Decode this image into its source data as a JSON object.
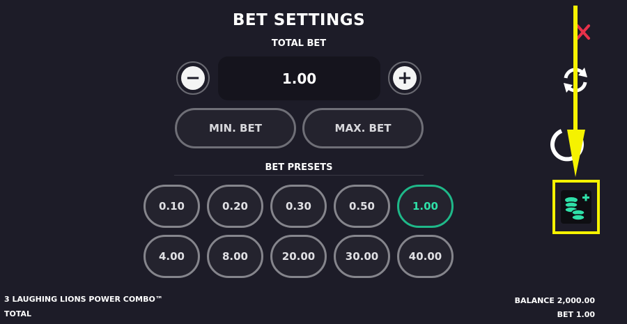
{
  "header": {
    "title": "BET SETTINGS",
    "total_bet_label": "TOTAL BET"
  },
  "bet": {
    "value": "1.00",
    "minus_symbol": "−",
    "plus_symbol": "+"
  },
  "buttons": {
    "min_bet": "MIN. BET",
    "max_bet": "MAX. BET"
  },
  "presets": {
    "label": "BET PRESETS",
    "selected": "1.00",
    "values": [
      "0.10",
      "0.20",
      "0.30",
      "0.50",
      "1.00",
      "4.00",
      "8.00",
      "20.00",
      "30.00",
      "40.00"
    ]
  },
  "footer": {
    "game_name": "3 LAUGHING LIONS POWER COMBO™",
    "total_label": "TOTAL",
    "balance_label": "BALANCE 2,000.00",
    "bet_label": "BET 1.00"
  },
  "side_icons": [
    "close-icon",
    "refresh-icon",
    "power-icon",
    "coins-plus-icon"
  ],
  "colors": {
    "background": "#1d1c28",
    "selected_accent": "#2fe0a8",
    "close_icon": "#e8314a",
    "highlight": "#f5f200"
  }
}
